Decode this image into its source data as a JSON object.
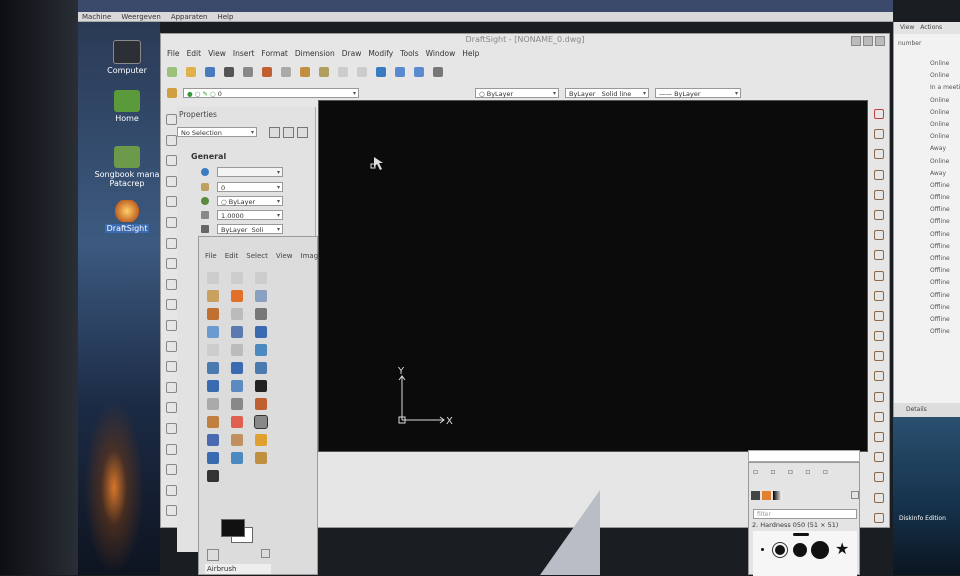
{
  "host": {
    "menu": [
      "Machine",
      "Weergeven",
      "Apparaten",
      "Help"
    ],
    "desktop_icons": [
      {
        "label": "Computer"
      },
      {
        "label": "Home"
      },
      {
        "label": "Songbook mana Patacrep"
      },
      {
        "label": "DraftSight"
      }
    ],
    "right_window": {
      "menu": [
        "View",
        "Actions"
      ],
      "field": "number",
      "statuses": [
        "Online",
        "Online",
        "In a meeti",
        "Online",
        "Online",
        "Online",
        "Online",
        "Away",
        "Online",
        "Away",
        "Offline",
        "Offline",
        "Offline",
        "Offline",
        "Offline",
        "Offline",
        "Offline",
        "Offline",
        "Offline",
        "Offline",
        "Offline",
        "Offline",
        "Offline"
      ],
      "details": "Details"
    },
    "desktop_right_icon_label": "DiskInfo Edition"
  },
  "draftsight": {
    "title": "DraftSight - [NONAME_0.dwg]",
    "menu": [
      "File",
      "Edit",
      "View",
      "Insert",
      "Format",
      "Dimension",
      "Draw",
      "Modify",
      "Tools",
      "Window",
      "Help"
    ],
    "layer_value": "0",
    "color_combo": "ByLayer",
    "linetype_combo_a": "ByLayer",
    "linetype_combo_b": "Solid line",
    "lineweight_combo": "—— ByLayer",
    "properties": {
      "title": "Properties",
      "selection": "No Selection",
      "section": "General",
      "layer": "0",
      "color": "ByLayer",
      "scale": "1.0000",
      "linetype_a": "ByLayer",
      "linetype_b": "Soli"
    },
    "axis": {
      "x": "X",
      "y": "Y"
    }
  },
  "gimp": {
    "menu": [
      "File",
      "Edit",
      "Select",
      "View",
      "Imag"
    ],
    "active_tool": "Airbrush"
  },
  "brushes": {
    "filter_placeholder": "filter",
    "brush_name": "2. Hardness 050 (51 × 51)"
  },
  "colors": {
    "canvas": "#0b0b0b",
    "window_bg": "#e6e6e6",
    "accent_blue": "#3a7cc0",
    "tool_orange": "#e0702a"
  }
}
